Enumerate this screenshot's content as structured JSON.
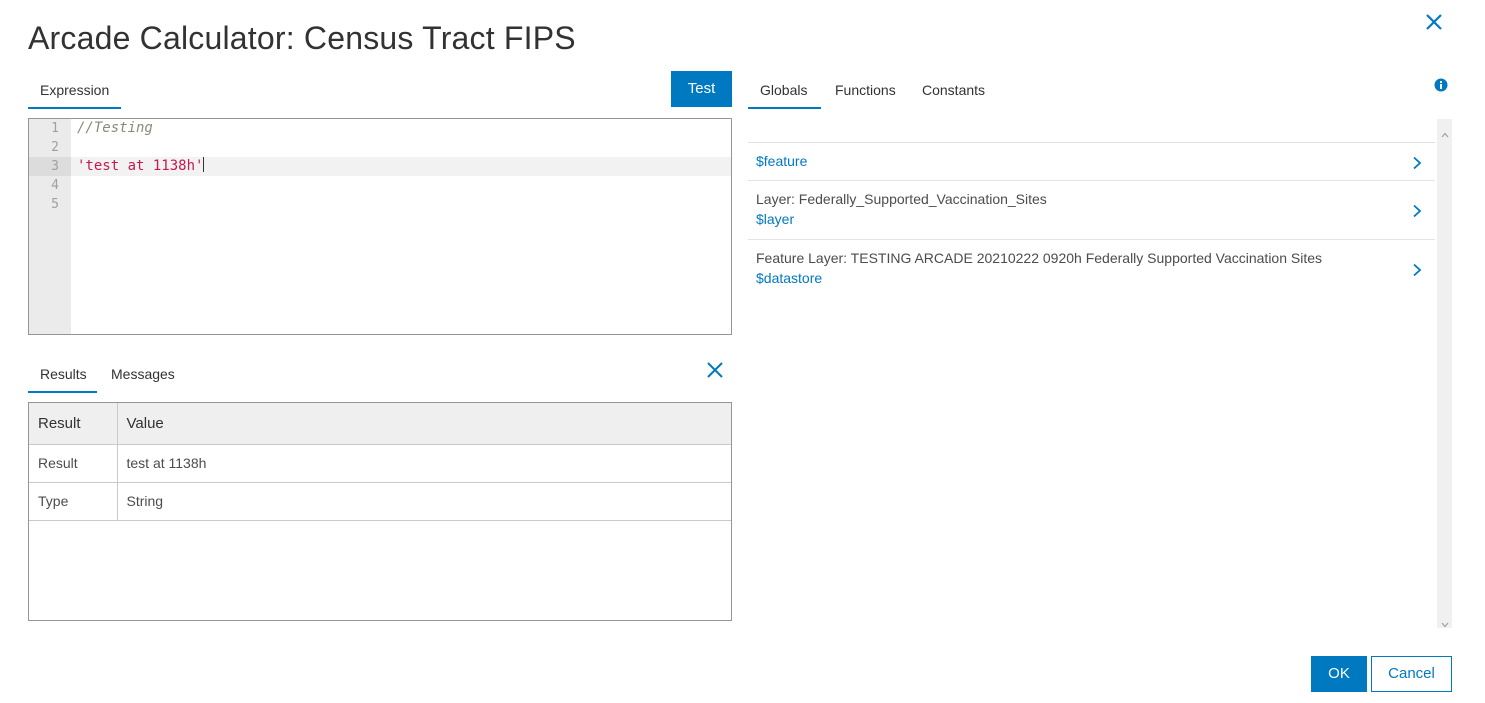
{
  "dialog": {
    "title": "Arcade Calculator: Census Tract FIPS"
  },
  "expression": {
    "tab_label": "Expression",
    "test_button": "Test",
    "lines": [
      {
        "number": "1",
        "text": "//Testing"
      },
      {
        "number": "2",
        "text": ""
      },
      {
        "number": "3",
        "text": "'test at 1138h'"
      },
      {
        "number": "4",
        "text": ""
      },
      {
        "number": "5",
        "text": ""
      }
    ],
    "current_line": "3"
  },
  "output": {
    "tabs": [
      {
        "label": "Results"
      },
      {
        "label": "Messages"
      }
    ],
    "active_tab": "Results",
    "headers": [
      "Result",
      "Value"
    ],
    "rows": [
      {
        "key": "Result",
        "value": "test at 1138h"
      },
      {
        "key": "Type",
        "value": "String"
      }
    ]
  },
  "reference": {
    "tabs": [
      {
        "label": "Globals"
      },
      {
        "label": "Functions"
      },
      {
        "label": "Constants"
      }
    ],
    "active_tab": "Globals",
    "items": [
      {
        "label": "",
        "var": "$feature"
      },
      {
        "label": "Layer: Federally_Supported_Vaccination_Sites",
        "var": "$layer"
      },
      {
        "label": "Feature Layer: TESTING ARCADE 20210222 0920h Federally Supported Vaccination Sites",
        "var": "$datastore"
      }
    ]
  },
  "footer": {
    "ok_label": "OK",
    "cancel_label": "Cancel"
  },
  "colors": {
    "accent": "#0079c1",
    "comment": "#8a8a7a",
    "string": "#c41a4c"
  },
  "icons": {
    "close": "close-icon",
    "info": "info-icon",
    "chevron": "chevron-right-icon"
  }
}
